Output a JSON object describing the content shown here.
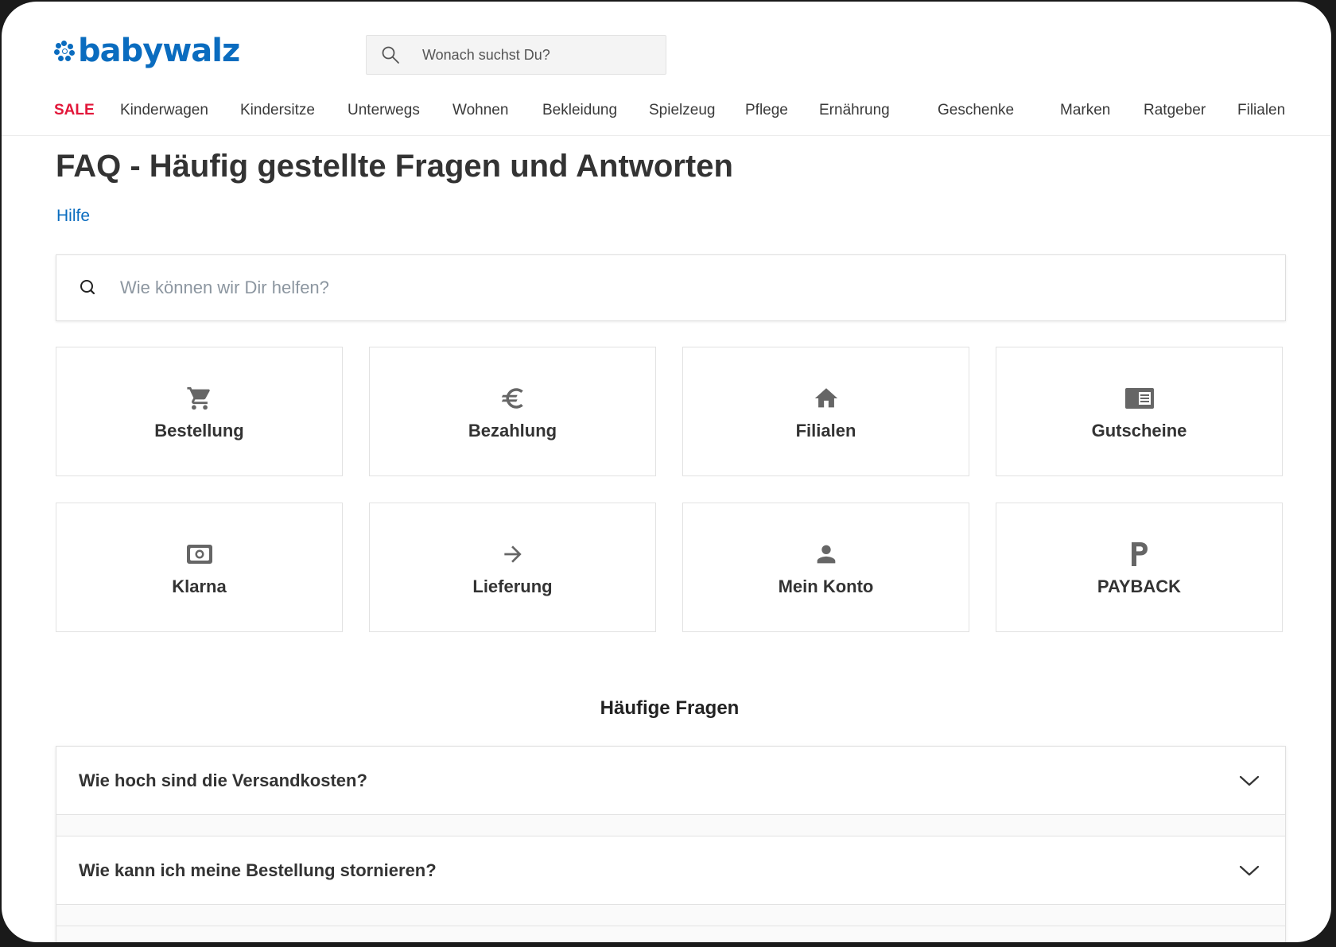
{
  "header": {
    "logo_text": "babywalz",
    "search_placeholder": "Wonach suchst Du?",
    "brand_color": "#0a6cbf"
  },
  "nav": {
    "items": [
      {
        "label": "SALE"
      },
      {
        "label": "Kinderwagen"
      },
      {
        "label": "Kindersitze"
      },
      {
        "label": "Unterwegs"
      },
      {
        "label": "Wohnen"
      },
      {
        "label": "Bekleidung"
      },
      {
        "label": "Spielzeug"
      },
      {
        "label": "Pflege"
      },
      {
        "label": "Ernährung"
      },
      {
        "label": "Geschenke"
      },
      {
        "label": "Marken"
      },
      {
        "label": "Ratgeber"
      },
      {
        "label": "Filialen"
      }
    ],
    "sale_color": "#e2173a"
  },
  "main": {
    "title": "FAQ - Häufig gestellte Fragen und Antworten",
    "breadcrumb": "Hilfe",
    "help_search_placeholder": "Wie können wir Dir helfen?",
    "categories": [
      {
        "label": "Bestellung",
        "icon": "cart-icon"
      },
      {
        "label": "Bezahlung",
        "icon": "euro-icon"
      },
      {
        "label": "Filialen",
        "icon": "home-icon"
      },
      {
        "label": "Gutscheine",
        "icon": "voucher-card-icon"
      },
      {
        "label": "Klarna",
        "icon": "klarna-money-icon"
      },
      {
        "label": "Lieferung",
        "icon": "arrow-right-icon"
      },
      {
        "label": "Mein Konto",
        "icon": "person-icon"
      },
      {
        "label": "PAYBACK",
        "icon": "payback-p-icon"
      }
    ],
    "faq_heading": "Häufige Fragen",
    "faq": [
      {
        "question": "Wie hoch sind die Versandkosten?"
      },
      {
        "question": "Wie kann ich meine Bestellung stornieren?"
      }
    ]
  }
}
